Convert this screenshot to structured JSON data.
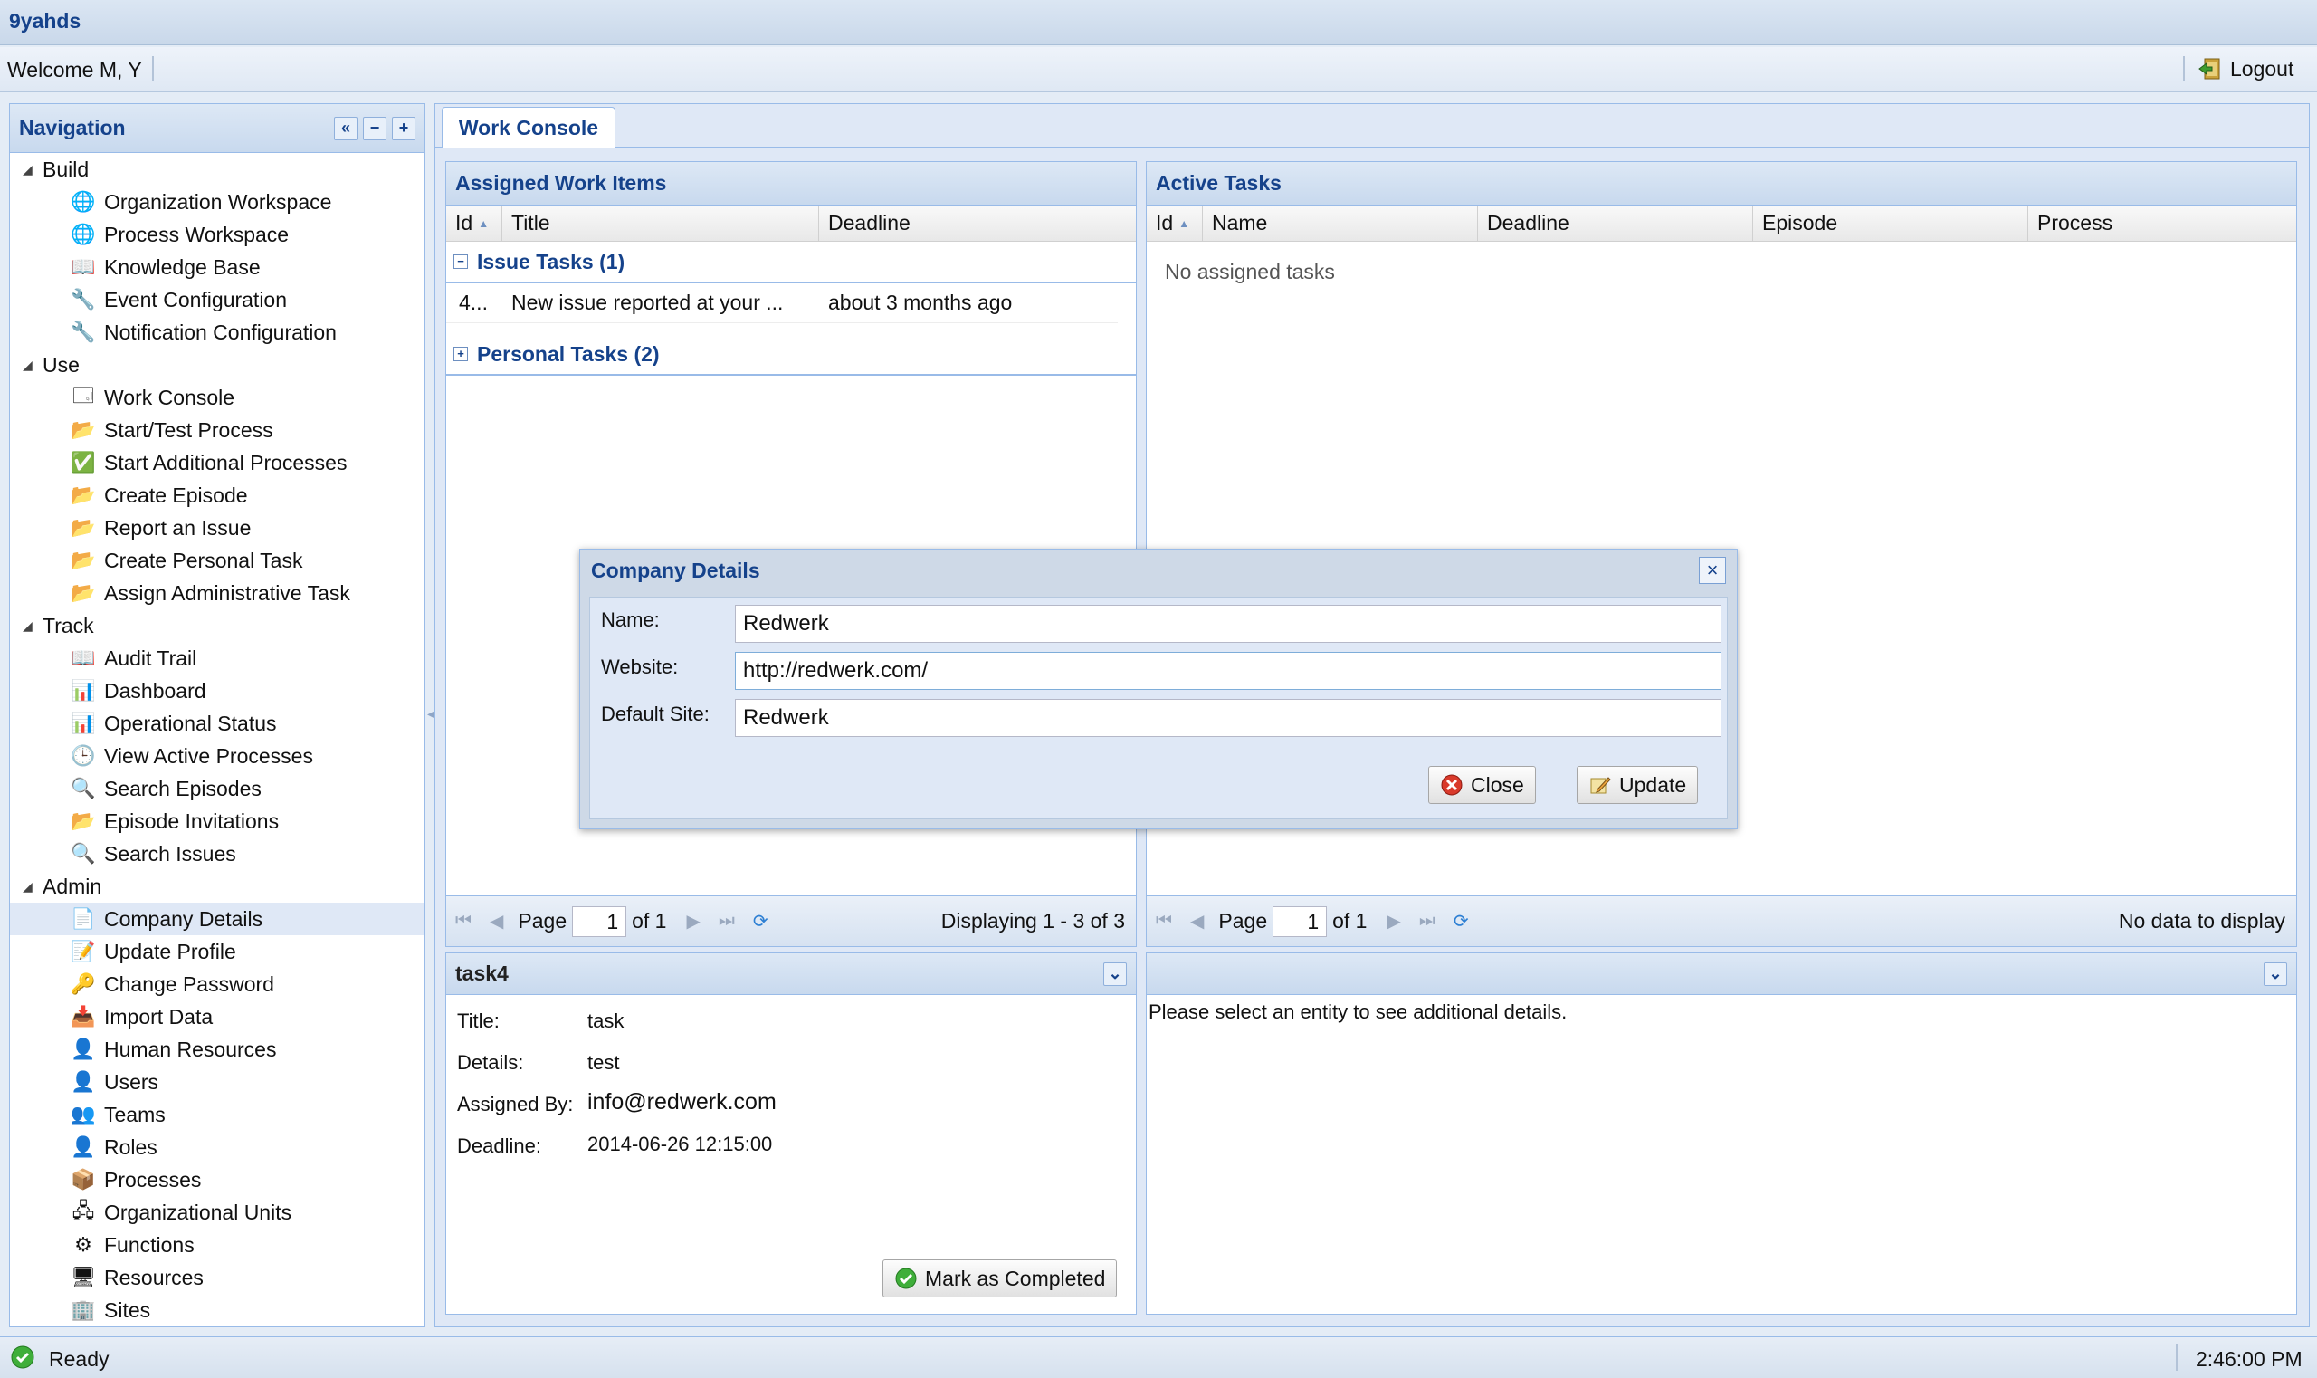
{
  "app": {
    "title": "9yahds",
    "welcome": "Welcome M, Y",
    "logout": "Logout"
  },
  "nav": {
    "title": "Navigation",
    "sections": [
      {
        "label": "Build",
        "items": [
          {
            "label": "Organization Workspace",
            "icon": "globe-icon"
          },
          {
            "label": "Process Workspace",
            "icon": "globe-icon"
          },
          {
            "label": "Knowledge Base",
            "icon": "book-icon"
          },
          {
            "label": "Event Configuration",
            "icon": "wrench-icon"
          },
          {
            "label": "Notification Configuration",
            "icon": "wrench-icon"
          }
        ]
      },
      {
        "label": "Use",
        "items": [
          {
            "label": "Work Console",
            "icon": "window-icon"
          },
          {
            "label": "Start/Test Process",
            "icon": "folder-add-icon"
          },
          {
            "label": "Start Additional Processes",
            "icon": "check-circle-icon"
          },
          {
            "label": "Create Episode",
            "icon": "folder-add-icon"
          },
          {
            "label": "Report an Issue",
            "icon": "folder-add-icon"
          },
          {
            "label": "Create Personal Task",
            "icon": "folder-add-icon"
          },
          {
            "label": "Assign Administrative Task",
            "icon": "folder-add-icon"
          }
        ]
      },
      {
        "label": "Track",
        "items": [
          {
            "label": "Audit Trail",
            "icon": "book-icon"
          },
          {
            "label": "Dashboard",
            "icon": "bar-chart-icon"
          },
          {
            "label": "Operational Status",
            "icon": "bar-chart-icon"
          },
          {
            "label": "View Active Processes",
            "icon": "clock-icon"
          },
          {
            "label": "Search Episodes",
            "icon": "search-icon"
          },
          {
            "label": "Episode Invitations",
            "icon": "folder-add-icon"
          },
          {
            "label": "Search Issues",
            "icon": "search-icon"
          }
        ]
      },
      {
        "label": "Admin",
        "items": [
          {
            "label": "Company Details",
            "icon": "document-icon",
            "selected": true
          },
          {
            "label": "Update Profile",
            "icon": "edit-icon"
          },
          {
            "label": "Change Password",
            "icon": "key-icon"
          },
          {
            "label": "Import Data",
            "icon": "import-icon"
          },
          {
            "label": "Human Resources",
            "icon": "user-icon"
          },
          {
            "label": "Users",
            "icon": "user-icon"
          },
          {
            "label": "Teams",
            "icon": "users-icon"
          },
          {
            "label": "Roles",
            "icon": "user-gray-icon"
          },
          {
            "label": "Processes",
            "icon": "box-icon"
          },
          {
            "label": "Organizational Units",
            "icon": "org-chart-icon"
          },
          {
            "label": "Functions",
            "icon": "gear-icon"
          },
          {
            "label": "Resources",
            "icon": "monitor-icon"
          },
          {
            "label": "Sites",
            "icon": "building-icon"
          }
        ]
      }
    ]
  },
  "main": {
    "tab": "Work Console",
    "assigned": {
      "title": "Assigned Work Items",
      "columns": [
        "Id",
        "Title",
        "Deadline"
      ],
      "groups": [
        {
          "label": "Issue Tasks (1)",
          "expanded": true,
          "rows": [
            {
              "id": "4...",
              "title": "New issue reported at your ...",
              "deadline": "about 3 months ago"
            }
          ]
        },
        {
          "label": "Personal Tasks (2)",
          "expanded": false
        }
      ],
      "pager": {
        "page_label": "Page",
        "page": "1",
        "of": "of 1",
        "display": "Displaying 1 - 3 of 3"
      }
    },
    "active": {
      "title": "Active Tasks",
      "columns": [
        "Id",
        "Name",
        "Deadline",
        "Episode",
        "Process"
      ],
      "empty": "No assigned tasks",
      "pager": {
        "page_label": "Page",
        "page": "1",
        "of": "of 1",
        "display": "No data to display"
      }
    },
    "task_details": {
      "title": "task4",
      "fields": [
        {
          "label": "Title:",
          "value": "task"
        },
        {
          "label": "Details:",
          "value": "test"
        },
        {
          "label": "Assigned By:",
          "value": "info@redwerk.com"
        },
        {
          "label": "Deadline:",
          "value": "2014-06-26 12:15:00"
        }
      ],
      "complete_button": "Mark as Completed"
    },
    "entity_details": {
      "message": "Please select an entity to see additional details."
    }
  },
  "dialog": {
    "title": "Company Details",
    "fields": [
      {
        "label": "Name:",
        "value": "Redwerk"
      },
      {
        "label": "Website:",
        "value": "http://redwerk.com/"
      },
      {
        "label": "Default Site:",
        "value": "Redwerk"
      }
    ],
    "close": "Close",
    "update": "Update"
  },
  "status": {
    "text": "Ready",
    "time": "2:46:00 PM"
  },
  "colors": {
    "accent": "#15428b",
    "border": "#99bbe8",
    "header_bg": "#dfe8f6"
  }
}
